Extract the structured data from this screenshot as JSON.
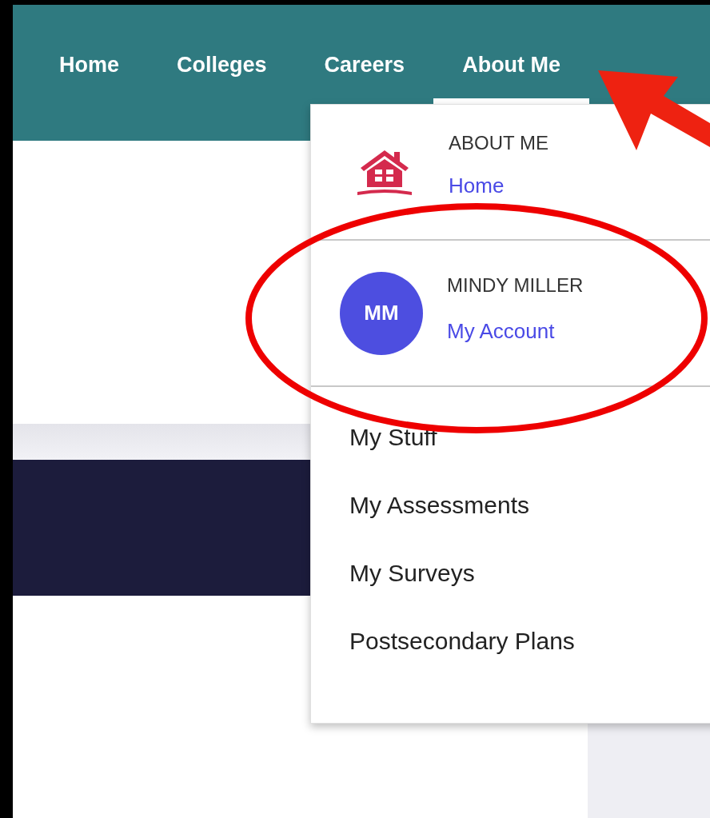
{
  "nav": {
    "items": [
      {
        "label": "Home",
        "selected": false
      },
      {
        "label": "Colleges",
        "selected": false
      },
      {
        "label": "Careers",
        "selected": false
      },
      {
        "label": "About Me",
        "selected": true
      }
    ]
  },
  "dropdown": {
    "header": {
      "title": "ABOUT ME",
      "link": "Home"
    },
    "account": {
      "initials": "MM",
      "name": "MINDY MILLER",
      "link": "My Account"
    },
    "items": [
      "My Stuff",
      "My Assessments",
      "My Surveys",
      "Postsecondary Plans"
    ]
  }
}
